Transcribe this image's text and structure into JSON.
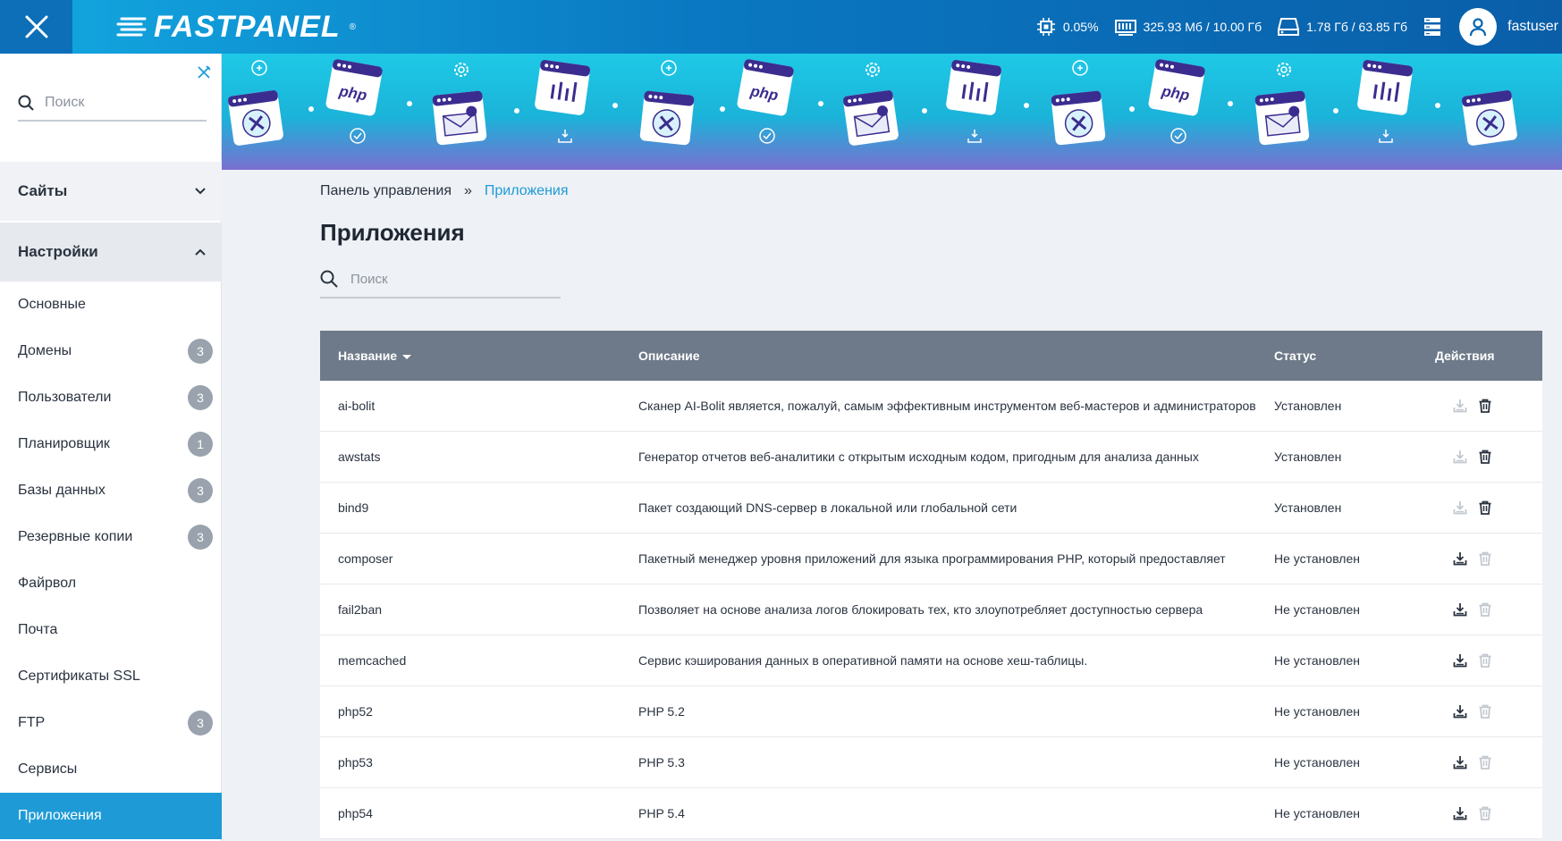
{
  "header": {
    "logo_text": "FASTPANEL",
    "logo_reg": "®",
    "cpu": "0.05%",
    "ram": "325.93 Мб / 10.00 Гб",
    "disk": "1.78 Гб / 63.85 Гб",
    "username": "fastuser",
    "icons": [
      "close-icon",
      "cpu-icon",
      "memory-icon",
      "disk-icon",
      "servers-icon",
      "user-icon"
    ]
  },
  "sidebar": {
    "search_placeholder": "Поиск",
    "sections": [
      {
        "label": "Сайты",
        "expanded": false
      },
      {
        "label": "Настройки",
        "expanded": true
      }
    ],
    "items": [
      {
        "label": "Основные",
        "badge": ""
      },
      {
        "label": "Домены",
        "badge": "3"
      },
      {
        "label": "Пользователи",
        "badge": "3"
      },
      {
        "label": "Планировщик",
        "badge": "1"
      },
      {
        "label": "Базы данных",
        "badge": "3"
      },
      {
        "label": "Резервные копии",
        "badge": "3"
      },
      {
        "label": "Файрвол",
        "badge": ""
      },
      {
        "label": "Почта",
        "badge": ""
      },
      {
        "label": "Сертификаты SSL",
        "badge": ""
      },
      {
        "label": "FTP",
        "badge": "3"
      },
      {
        "label": "Сервисы",
        "badge": ""
      },
      {
        "label": "Приложения",
        "badge": "",
        "active": true
      }
    ]
  },
  "breadcrumb": {
    "root": "Панель управления",
    "separator": "»",
    "current": "Приложения"
  },
  "page": {
    "title": "Приложения",
    "search_placeholder": "Поиск"
  },
  "table": {
    "columns": {
      "name": "Название",
      "description": "Описание",
      "status": "Статус",
      "actions": "Действия"
    },
    "rows": [
      {
        "name": "ai-bolit",
        "description": "Сканер AI-Bolit является, пожалуй, самым эффективным инструментом веб-мастеров и администраторов",
        "status": "Установлен",
        "installed": true
      },
      {
        "name": "awstats",
        "description": "Генератор отчетов веб-аналитики с открытым исходным кодом, пригодным для анализа данных",
        "status": "Установлен",
        "installed": true
      },
      {
        "name": "bind9",
        "description": "Пакет создающий DNS-сервер в локальной или глобальной сети",
        "status": "Установлен",
        "installed": true
      },
      {
        "name": "composer",
        "description": "Пакетный менеджер уровня приложений для языка программирования PHP, который предоставляет",
        "status": "Не установлен",
        "installed": false
      },
      {
        "name": "fail2ban",
        "description": "Позволяет на основе анализа логов блокировать тех, кто злоупотребляет доступностью сервера",
        "status": "Не установлен",
        "installed": false
      },
      {
        "name": "memcached",
        "description": "Сервис кэширования данных в оперативной памяти на основе хеш-таблицы.",
        "status": "Не установлен",
        "installed": false
      },
      {
        "name": "php52",
        "description": "PHP 5.2",
        "status": "Не установлен",
        "installed": false
      },
      {
        "name": "php53",
        "description": "PHP 5.3",
        "status": "Не установлен",
        "installed": false
      },
      {
        "name": "php54",
        "description": "PHP 5.4",
        "status": "Не установлен",
        "installed": false
      }
    ]
  },
  "banner": {
    "tile_labels": [
      "php",
      "php",
      "php"
    ],
    "colors": {
      "top": "#1ec9e6",
      "bottom": "#7a6fd0",
      "tile": "#ffffff",
      "tile_accent": "#3b2d8f"
    }
  },
  "colors": {
    "accent": "#1e9bd6",
    "header_from": "#13a8e0",
    "header_to": "#0a5ea8",
    "table_head": "#6e7a89",
    "badge": "#9aa3ad"
  }
}
